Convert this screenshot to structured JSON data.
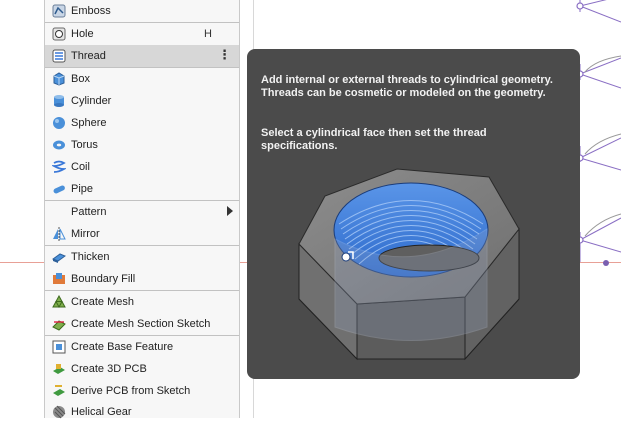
{
  "menu": {
    "items": [
      {
        "label": "Emboss",
        "icon": "emboss-icon"
      },
      {
        "label": "Hole",
        "icon": "hole-icon",
        "shortcut": "H"
      },
      {
        "label": "Thread",
        "icon": "thread-icon",
        "more": "⋮"
      },
      {
        "label": "Box",
        "icon": "box-icon"
      },
      {
        "label": "Cylinder",
        "icon": "cylinder-icon"
      },
      {
        "label": "Sphere",
        "icon": "sphere-icon"
      },
      {
        "label": "Torus",
        "icon": "torus-icon"
      },
      {
        "label": "Coil",
        "icon": "coil-icon"
      },
      {
        "label": "Pipe",
        "icon": "pipe-icon"
      },
      {
        "label": "Pattern"
      },
      {
        "label": "Mirror",
        "icon": "mirror-icon"
      },
      {
        "label": "Thicken",
        "icon": "thicken-icon"
      },
      {
        "label": "Boundary Fill",
        "icon": "boundary-fill-icon"
      },
      {
        "label": "Create Mesh",
        "icon": "create-mesh-icon"
      },
      {
        "label": "Create Mesh Section Sketch",
        "icon": "mesh-section-sketch-icon"
      },
      {
        "label": "Create Base Feature",
        "icon": "base-feature-icon"
      },
      {
        "label": "Create 3D PCB",
        "icon": "pcb-3d-icon"
      },
      {
        "label": "Derive PCB from Sketch",
        "icon": "derive-pcb-icon"
      },
      {
        "label": "Helical Gear",
        "icon": "helical-gear-icon"
      }
    ]
  },
  "tooltip": {
    "description": "Add internal or external threads to cylindrical geometry. Threads can be cosmetic or modeled on the geometry.",
    "instruction": "Select a cylindrical face then set the thread specifications."
  },
  "colors": {
    "highlight": "#d7d7d7",
    "tooltip_bg": "#4b4b4b",
    "thread_blue": "#3a78d8"
  }
}
